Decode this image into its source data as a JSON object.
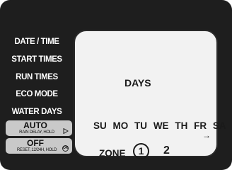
{
  "menu": {
    "items": [
      {
        "label": "DATE / TIME"
      },
      {
        "label": "START TIMES"
      },
      {
        "label": "RUN TIMES"
      },
      {
        "label": "ECO MODE"
      },
      {
        "label": "WATER DAYS"
      }
    ],
    "auto": {
      "title": "AUTO",
      "subtitle": "RAIN DELAY, HOLD"
    },
    "off": {
      "title": "OFF",
      "subtitle": "RESET, 12/24H, HOLD"
    }
  },
  "screen": {
    "heading": "DAYS",
    "days": [
      "SU",
      "MO",
      "TU",
      "WE",
      "TH",
      "FR",
      "SA"
    ],
    "next_symbol": "→",
    "zone_label": "ZONE",
    "zones": [
      "1",
      "2"
    ],
    "selected_zone": "1"
  },
  "icons": {
    "auto_action": "play-triangle-icon",
    "off_action": "ok-circle-icon",
    "pointer": "selection-pointer-icon"
  },
  "colors": {
    "body": "#1e1e1e",
    "screen": "#f2f2f2",
    "button": "#c9c9c9"
  }
}
